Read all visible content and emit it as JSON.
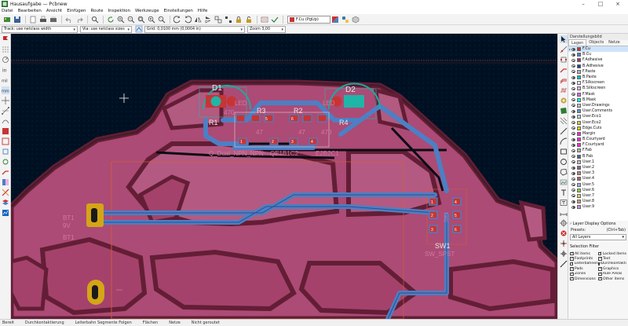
{
  "window": {
    "title": "Hausaufgabe — Pcbnew",
    "controls": {
      "minimize": "–",
      "maximize": "□",
      "close": "×"
    }
  },
  "menu": [
    "Datei",
    "Bearbeiten",
    "Ansicht",
    "Einfügen",
    "Route",
    "Inspektion",
    "Werkzeuge",
    "Einstellungen",
    "Hilfe"
  ],
  "toolbar": {
    "layer_select": "F.Cu (PgUp)",
    "layer_color": "#c83434"
  },
  "toolbar2": {
    "track": "Track: use netclass width",
    "via": "Via: use netclass sizes",
    "grid": "Grid: 0,0100 mm (0,0004 in)",
    "zoom": "Zoom 3,00"
  },
  "board": {
    "refs": {
      "d1": "D1",
      "d2": "D2",
      "r1": "R1",
      "r3": "R3",
      "r2": "R2",
      "r4": "R4",
      "bt1": "BT1",
      "sw1": "SW1"
    },
    "values": {
      "led_left": "LED",
      "led_right": "LED",
      "r470_a": "470",
      "r470_b": "470",
      "r47": "47",
      "r47_b": "47",
      "bt_9v": "9V",
      "bt_fab": "BT1",
      "sw_value": "SW_SPST",
      "sw_fab": "SW1",
      "q_dual": "Q_Dual_NPN_NPN",
      "qmark1": "QE1B1C2",
      "qmark2": "E2B2C1"
    },
    "pads": {
      "q1": "1",
      "q2": "2",
      "q3": "3",
      "q4": "4",
      "q5": "5",
      "q6": "6",
      "sw1": "1",
      "sw2": "2",
      "sw3": "3",
      "sw4": "4",
      "sw5": "5",
      "sw6": "6"
    }
  },
  "panel": {
    "header": "Darstellungsbild",
    "tabs": [
      "Lagen",
      "Objects",
      "Netze"
    ],
    "active_tab": "Lagen",
    "layers": [
      {
        "name": "F.Cu",
        "color": "#c83434",
        "selected": true
      },
      {
        "name": "B.Cu",
        "color": "#4d7fc4"
      },
      {
        "name": "F.Adhesive",
        "color": "#8a3a8a"
      },
      {
        "name": "B.Adhesive",
        "color": "#1f3d9a"
      },
      {
        "name": "F.Paste",
        "color": "#b4b4b4"
      },
      {
        "name": "B.Paste",
        "color": "#00c2c2"
      },
      {
        "name": "F.Silkscreen",
        "color": "#e8e8e8"
      },
      {
        "name": "B.Silkscreen",
        "color": "#e8b4e8"
      },
      {
        "name": "F.Mask",
        "color": "#d864ff"
      },
      {
        "name": "B.Mask",
        "color": "#02ffee"
      },
      {
        "name": "User.Drawings",
        "color": "#c2c2c2"
      },
      {
        "name": "User.Comments",
        "color": "#5994dc"
      },
      {
        "name": "User.Eco1",
        "color": "#b4dbd2"
      },
      {
        "name": "User.Eco2",
        "color": "#d8c852"
      },
      {
        "name": "Edge.Cuts",
        "color": "#d0d200"
      },
      {
        "name": "Margin",
        "color": "#ff26e2"
      },
      {
        "name": "B.Courtyard",
        "color": "#ff26e2"
      },
      {
        "name": "F.Courtyard",
        "color": "#ff26e2"
      },
      {
        "name": "F.Fab",
        "color": "#afafaf"
      },
      {
        "name": "B.Fab",
        "color": "#585d84"
      },
      {
        "name": "User.1",
        "color": "#c2c2c2"
      },
      {
        "name": "User.2",
        "color": "#89619a"
      },
      {
        "name": "User.3",
        "color": "#b28c6a"
      },
      {
        "name": "User.4",
        "color": "#b15c6f"
      },
      {
        "name": "User.5",
        "color": "#a0b4c8"
      },
      {
        "name": "User.6",
        "color": "#8ccc40"
      },
      {
        "name": "User.7",
        "color": "#e4d064"
      },
      {
        "name": "User.8",
        "color": "#c2a26d"
      },
      {
        "name": "User.9",
        "color": "#cd8ed8"
      }
    ],
    "layer_display_options": "Layer Display Options",
    "presets_label": "Presets:",
    "presets_hint": "(Ctrl+Tab)",
    "presets_value": "All Layers",
    "selection_filter": "Selection Filter",
    "filters": [
      "All items",
      "Locked items",
      "Footprints",
      "Text",
      "Leiterbahnen",
      "Durchkontaktierungen",
      "Pads",
      "Graphics",
      "Zones",
      "Rule Areas",
      "Dimensions",
      "Other items"
    ]
  },
  "status": [
    "Bereit",
    "Durchkontaktierung",
    "Leiterbahn Segmente Folgen",
    "Flächen",
    "Netze",
    "Nicht geroutet"
  ]
}
